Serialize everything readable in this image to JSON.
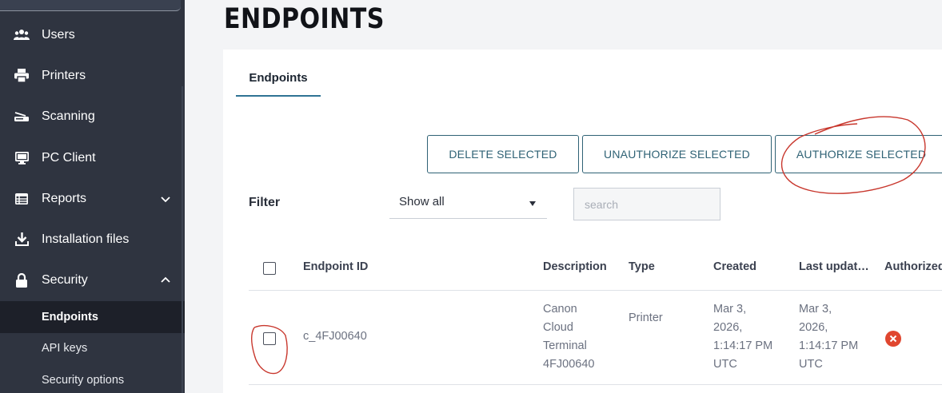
{
  "sidebar": {
    "items": [
      {
        "label": "Users",
        "icon": "users-icon"
      },
      {
        "label": "Printers",
        "icon": "printer-icon"
      },
      {
        "label": "Scanning",
        "icon": "scanner-icon"
      },
      {
        "label": "PC Client",
        "icon": "monitor-icon"
      },
      {
        "label": "Reports",
        "icon": "table-icon"
      },
      {
        "label": "Installation files",
        "icon": "download-icon"
      },
      {
        "label": "Security",
        "icon": "lock-icon"
      }
    ],
    "security_subitems": [
      {
        "label": "Endpoints",
        "active": true
      },
      {
        "label": "API keys",
        "active": false
      },
      {
        "label": "Security options",
        "active": false
      }
    ]
  },
  "page": {
    "title": "ENDPOINTS"
  },
  "tabs": [
    {
      "label": "Endpoints",
      "active": true
    }
  ],
  "toolbar": {
    "delete_label": "DELETE SELECTED",
    "unauthorize_label": "UNAUTHORIZE SELECTED",
    "authorize_label": "AUTHORIZE SELECTED"
  },
  "filter": {
    "label": "Filter",
    "selected": "Show all",
    "search_placeholder": "search"
  },
  "table": {
    "columns": [
      "Endpoint ID",
      "Description",
      "Type",
      "Created",
      "Last updat…",
      "Authorized"
    ],
    "rows": [
      {
        "endpoint_id": "c_4FJ00640",
        "description": [
          "Canon",
          "Cloud",
          "Terminal",
          "4FJ00640"
        ],
        "type": "Printer",
        "created": [
          "Mar 3,",
          "2026,",
          "1:14:17 PM",
          "UTC"
        ],
        "last_updated": [
          "Mar 3,",
          "2026,",
          "1:14:17 PM",
          "UTC"
        ],
        "authorized": false
      }
    ]
  },
  "colors": {
    "sidebar_bg": "#2f3440",
    "sidebar_active_bg": "#1d2029",
    "accent": "#2f6275",
    "tab_underline": "#2f7394",
    "unauthorized": "#e0462f",
    "annotation": "#c8372d"
  }
}
